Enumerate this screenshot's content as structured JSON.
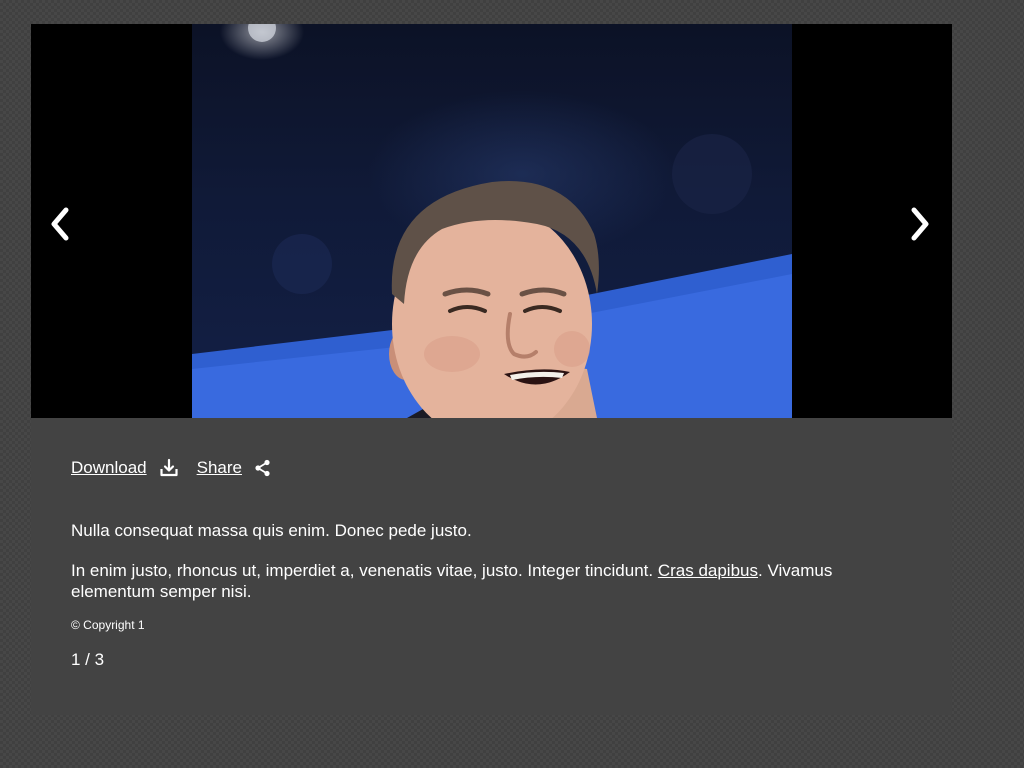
{
  "viewer": {
    "image_alt": "Man smiling on stage in front of a blue background",
    "prev_icon": "chevron-left-icon",
    "next_icon": "chevron-right-icon"
  },
  "actions": {
    "download_label": "Download",
    "download_icon": "download-icon",
    "share_label": "Share",
    "share_icon": "share-icon"
  },
  "caption": {
    "summary": "Nulla consequat massa quis enim. Donec pede justo.",
    "body_before_link": "In enim justo, rhoncus ut, imperdiet a, venenatis vitae, justo. Integer tincidunt. ",
    "body_link": "Cras dapibus",
    "body_after_link": ". Vivamus elementum semper nisi.",
    "copyright": "© Copyright 1"
  },
  "pagination": {
    "counter": "1 / 3"
  },
  "colors": {
    "page_background": "#474747",
    "panel_background": "#434343",
    "stage_background": "#000000",
    "text": "#ffffff"
  }
}
